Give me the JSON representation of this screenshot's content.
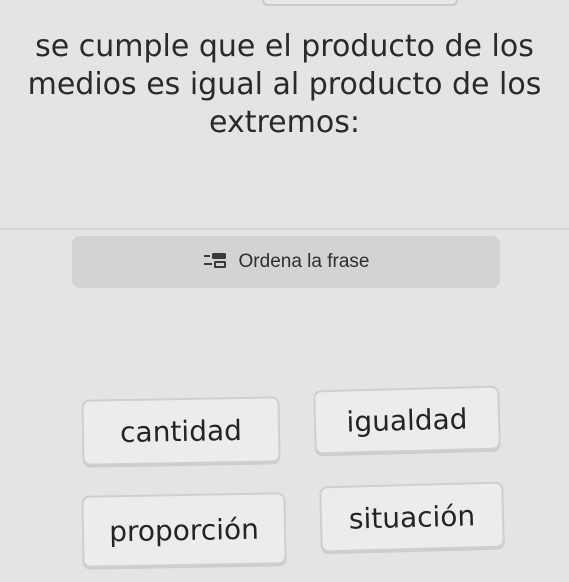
{
  "question": {
    "text": "se cumple que el producto de los medios es igual al producto de los extremos:"
  },
  "instruction": {
    "icon": "reorder-words-icon",
    "label": "Ordena la frase"
  },
  "word_bank": {
    "tiles": [
      {
        "label": "cantidad"
      },
      {
        "label": "igualdad"
      },
      {
        "label": "proporción"
      },
      {
        "label": "situación"
      }
    ]
  }
}
